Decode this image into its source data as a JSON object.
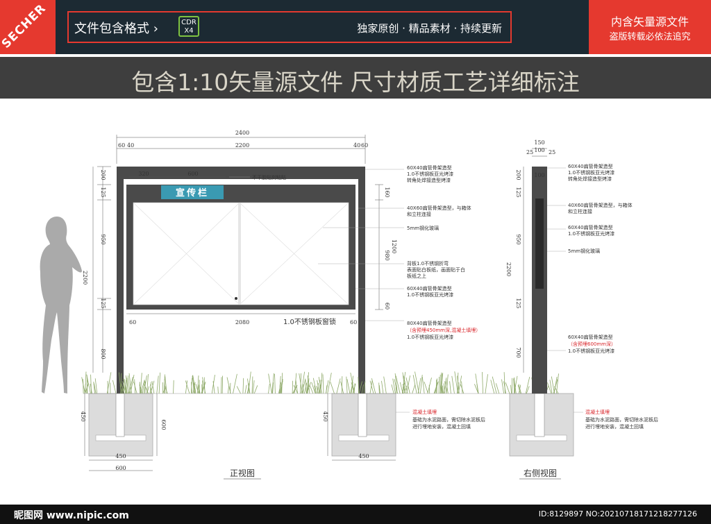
{
  "header": {
    "logo_text": "SECHER",
    "format_label": "文件包含格式 ›",
    "format_badge": "CDR X4",
    "tagline": "独家原创 · 精品素材 · 持续更新",
    "red_line1": "内含矢量源文件",
    "red_line2": "盗版转载必依法追究"
  },
  "headline": "包含1:10矢量源文件 尺寸材质工艺详细标注",
  "front": {
    "sign_text": "宣传栏",
    "lock_label": "1.0不锈钢板窗锁",
    "caption": "正视图",
    "dims": {
      "total_width": "2400",
      "inner_width": "2200",
      "left_a": "60",
      "left_b": "40",
      "right_a": "40",
      "right_b": "60",
      "d320": "320",
      "d600": "600",
      "h200": "200",
      "h125": "125",
      "h950": "950",
      "h125b": "125",
      "h800": "800",
      "h2200": "2200",
      "r160": "160",
      "r1200": "1200",
      "r980": "980",
      "r60": "60",
      "b60l": "60",
      "b2080": "2080",
      "b60r": "60",
      "f450h": "450",
      "f600h": "600",
      "f450w": "450",
      "f600w": "600",
      "m450h": "450",
      "m450w": "450"
    },
    "notes": {
      "n_pin": "不干胶贴刻粘贴",
      "n1": [
        "60X40扁管骨架造型",
        "1.0不锈钢板亚光烤漆",
        "转角处焊接造型烤漆"
      ],
      "n2": [
        "40X60扁管骨架造型，与箱体",
        "和立柱连接"
      ],
      "n3": [
        "5mm钢化玻璃"
      ],
      "n4": [
        "背板1.0不锈钢折弯",
        "表面贴白板纸，画面贴于白",
        "板纸之上"
      ],
      "n5": [
        "60X40扁管骨架造型",
        "1.0不锈钢板亚光烤漆"
      ],
      "n6a": "80X40扁管骨架造型",
      "n6b": "（含预埋450mm深,混凝土填埋）",
      "n6c": "1.0不锈钢板亚光烤漆",
      "f_red": "混凝土填埋",
      "f_body": [
        "基础为水泥路面，需切除水泥板后",
        "进行埋地安装，混凝土回填"
      ]
    }
  },
  "side": {
    "caption": "右侧视图",
    "dims": {
      "w150": "150",
      "w100": "100",
      "w25l": "25",
      "w25r": "25",
      "w100b": "100",
      "h200": "200",
      "h125": "125",
      "h950": "950",
      "h2200": "2200",
      "h125b": "125",
      "h700": "700"
    },
    "notes": {
      "s1": [
        "60X40扁管骨架造型",
        "1.0不锈钢板亚光烤漆",
        "转角处焊接造型烤漆"
      ],
      "s2": [
        "40X60扁管骨架造型，与箱体",
        "和立柱连接"
      ],
      "s3": [
        "60X40扁管骨架造型",
        "1.0不锈钢板亚光烤漆"
      ],
      "s4": "5mm钢化玻璃",
      "s5a": "60X40扁管骨架造型",
      "s5b": "（含预埋600mm深）",
      "s5c": "1.0不锈钢板亚光烤漆",
      "f_red": "混凝土填埋",
      "f_body": [
        "基础为水泥路面，需切除水泥板后",
        "进行埋地安装，混凝土回填"
      ]
    }
  },
  "watermark": {
    "left": "昵图网 www.nipic.com",
    "right": "ID:8129897 NO:20210718171218277126"
  },
  "colors": {
    "red": "#e5392f",
    "navy": "#1c2a33",
    "frame": "#4a4a4a",
    "sign": "#3a9ab2",
    "grass": "#8faa6a"
  }
}
